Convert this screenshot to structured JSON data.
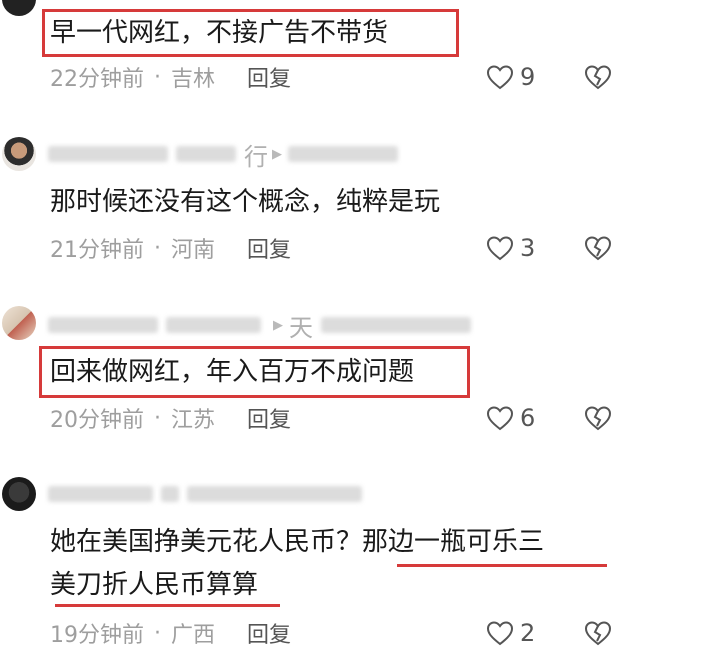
{
  "comments": [
    {
      "text_lines": [
        "早一代网红，不接广告不带货"
      ],
      "time": "22分钟前",
      "location": "吉林",
      "reply_label": "回复",
      "likes": "9"
    },
    {
      "username_partial": "行",
      "text_lines": [
        "那时候还没有这个概念，纯粹是玩"
      ],
      "time": "21分钟前",
      "location": "河南",
      "reply_label": "回复",
      "likes": "3"
    },
    {
      "username_partial": "天",
      "text_lines": [
        "回来做网红，年入百万不成问题"
      ],
      "time": "20分钟前",
      "location": "江苏",
      "reply_label": "回复",
      "likes": "6"
    },
    {
      "text_lines": [
        "她在美国挣美元花人民币？那边一瓶可乐三",
        "美刀折人民币算算"
      ],
      "time": "19分钟前",
      "location": "广西",
      "reply_label": "回复",
      "likes": "2"
    }
  ],
  "meta_separator": "·",
  "colors": {
    "highlight_red": "#d63a3a",
    "text": "#1a1a1a",
    "meta_text": "#9e9e9e"
  },
  "icons": {
    "like": "heart-outline-icon",
    "dislike": "broken-heart-icon",
    "reply_arrow": "play-triangle-icon"
  }
}
